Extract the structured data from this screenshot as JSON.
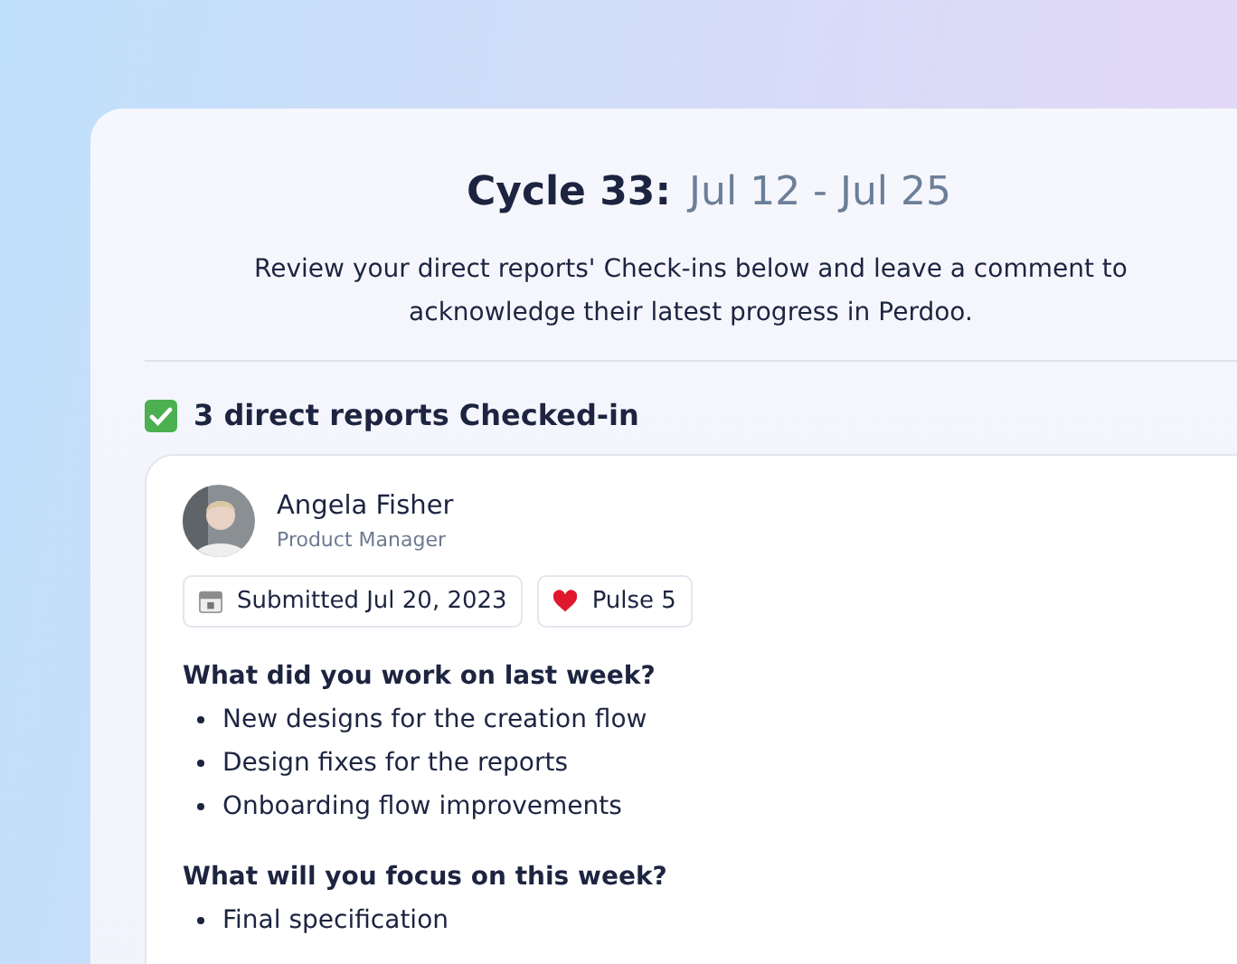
{
  "header": {
    "title": "Cycle 33:",
    "dates": "Jul 12 - Jul 25",
    "description": "Review your direct reports' Check-ins below and leave a comment to acknowledge their latest progress in Perdoo."
  },
  "section": {
    "title": "3 direct reports Checked-in"
  },
  "checkin": {
    "name": "Angela Fisher",
    "role": "Product Manager",
    "badges": [
      {
        "kind": "calendar",
        "label": "Submitted Jul 20, 2023"
      },
      {
        "kind": "heart",
        "label": "Pulse 5"
      }
    ],
    "questions": [
      {
        "question": "What did you work on last week?",
        "answers": [
          "New designs for the creation flow",
          "Design fixes for the reports",
          "Onboarding flow improvements"
        ]
      },
      {
        "question": "What will you focus on this week?",
        "answers": [
          "Final specification"
        ]
      }
    ]
  }
}
